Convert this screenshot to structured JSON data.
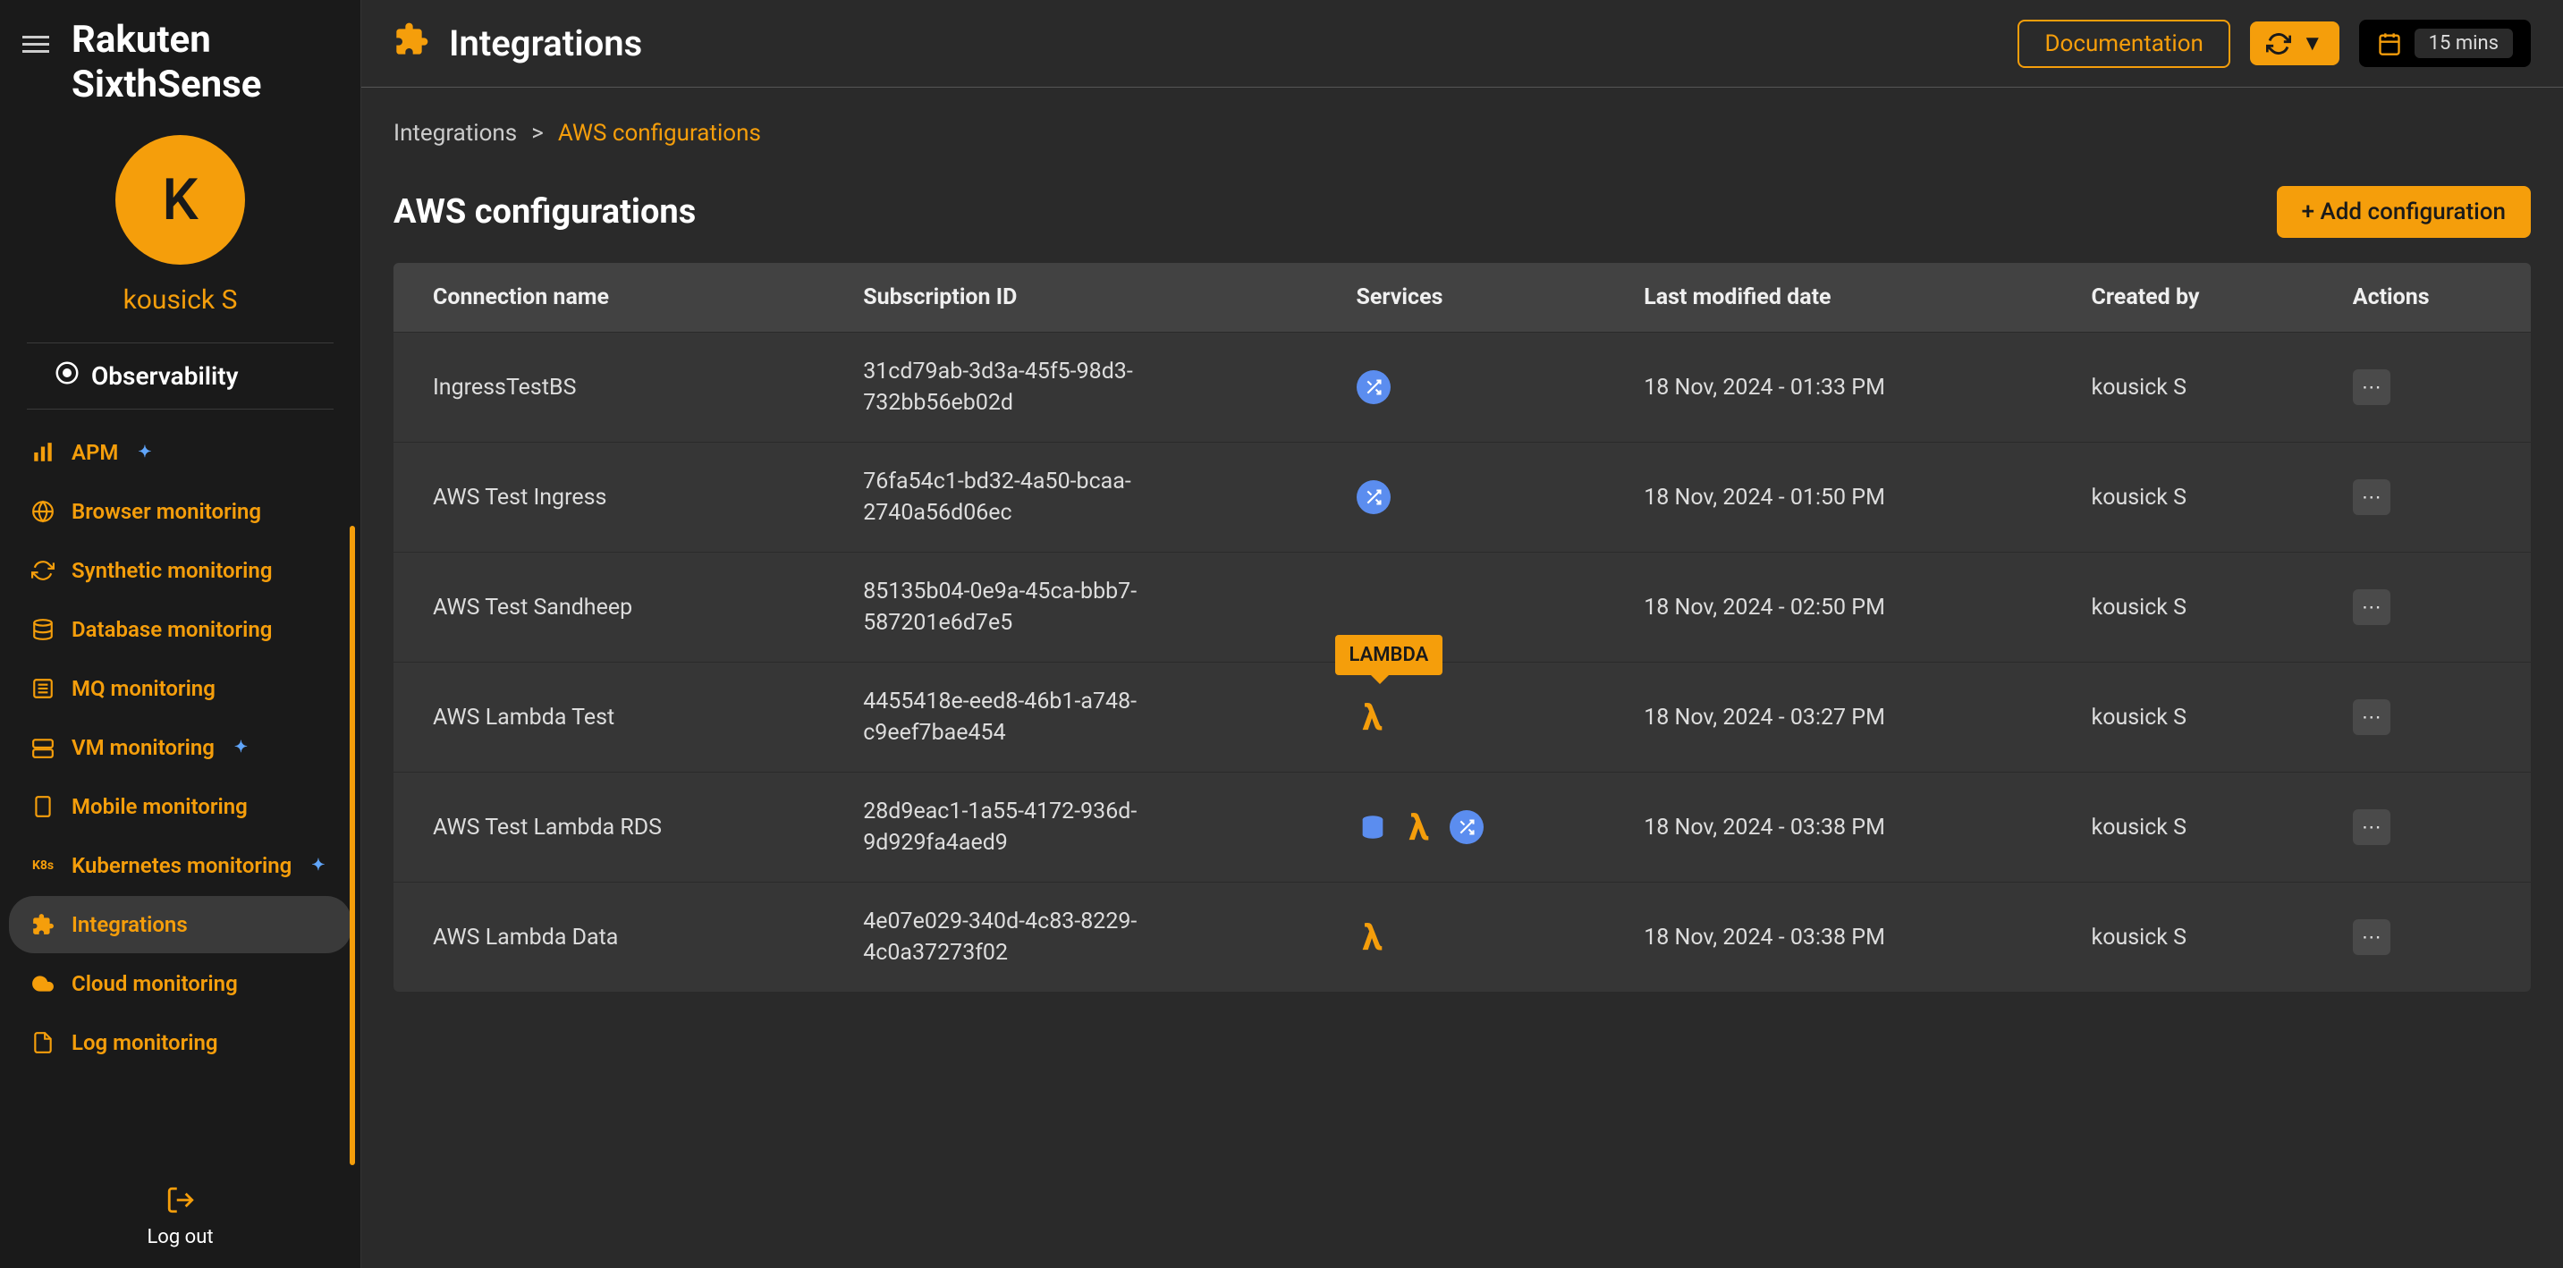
{
  "brand": "Rakuten SixthSense",
  "avatar_initial": "K",
  "username": "kousick S",
  "section_label": "Observability",
  "nav": [
    {
      "label": "APM",
      "icon": "bar-chart",
      "sparkle": true
    },
    {
      "label": "Browser monitoring",
      "icon": "globe"
    },
    {
      "label": "Synthetic monitoring",
      "icon": "sync"
    },
    {
      "label": "Database monitoring",
      "icon": "database"
    },
    {
      "label": "MQ monitoring",
      "icon": "list"
    },
    {
      "label": "VM monitoring",
      "icon": "server",
      "sparkle": true
    },
    {
      "label": "Mobile monitoring",
      "icon": "mobile"
    },
    {
      "label": "Kubernetes monitoring",
      "icon": "k8s",
      "sparkle": true
    },
    {
      "label": "Integrations",
      "icon": "puzzle",
      "active": true
    },
    {
      "label": "Cloud monitoring",
      "icon": "cloud"
    },
    {
      "label": "Log monitoring",
      "icon": "document"
    }
  ],
  "logout_label": "Log out",
  "page_title": "Integrations",
  "doc_button": "Documentation",
  "time_range": "15 mins",
  "breadcrumb": {
    "root": "Integrations",
    "sep": ">",
    "current": "AWS configurations"
  },
  "subtitle": "AWS configurations",
  "add_button": "+ Add configuration",
  "tooltip": "LAMBDA",
  "columns": [
    "Connection name",
    "Subscription ID",
    "Services",
    "Last modified date",
    "Created by",
    "Actions"
  ],
  "rows": [
    {
      "name": "IngressTestBS",
      "id_line1": "31cd79ab-3d3a-45f5-98d3-",
      "id_line2": "732bb56eb02d",
      "services": [
        "shuffle"
      ],
      "date": "18 Nov, 2024 - 01:33 PM",
      "by": "kousick S"
    },
    {
      "name": "AWS Test Ingress",
      "id_line1": "76fa54c1-bd32-4a50-bcaa-",
      "id_line2": "2740a56d06ec",
      "services": [
        "shuffle"
      ],
      "date": "18 Nov, 2024 - 01:50 PM",
      "by": "kousick S"
    },
    {
      "name": "AWS Test Sandheep",
      "id_line1": "85135b04-0e9a-45ca-bbb7-",
      "id_line2": "587201e6d7e5",
      "services": [],
      "date": "18 Nov, 2024 - 02:50 PM",
      "by": "kousick S"
    },
    {
      "name": "AWS Lambda Test",
      "id_line1": "4455418e-eed8-46b1-a748-",
      "id_line2": "c9eef7bae454",
      "services": [
        "lambda"
      ],
      "tooltip": true,
      "date": "18 Nov, 2024 - 03:27 PM",
      "by": "kousick S"
    },
    {
      "name": "AWS Test Lambda RDS",
      "id_line1": "28d9eac1-1a55-4172-936d-",
      "id_line2": "9d929fa4aed9",
      "services": [
        "db",
        "lambda",
        "shuffle"
      ],
      "date": "18 Nov, 2024 - 03:38 PM",
      "by": "kousick S"
    },
    {
      "name": "AWS Lambda Data",
      "id_line1": "4e07e029-340d-4c83-8229-",
      "id_line2": "4c0a37273f02",
      "services": [
        "lambda"
      ],
      "date": "18 Nov, 2024 - 03:38 PM",
      "by": "kousick S"
    }
  ]
}
